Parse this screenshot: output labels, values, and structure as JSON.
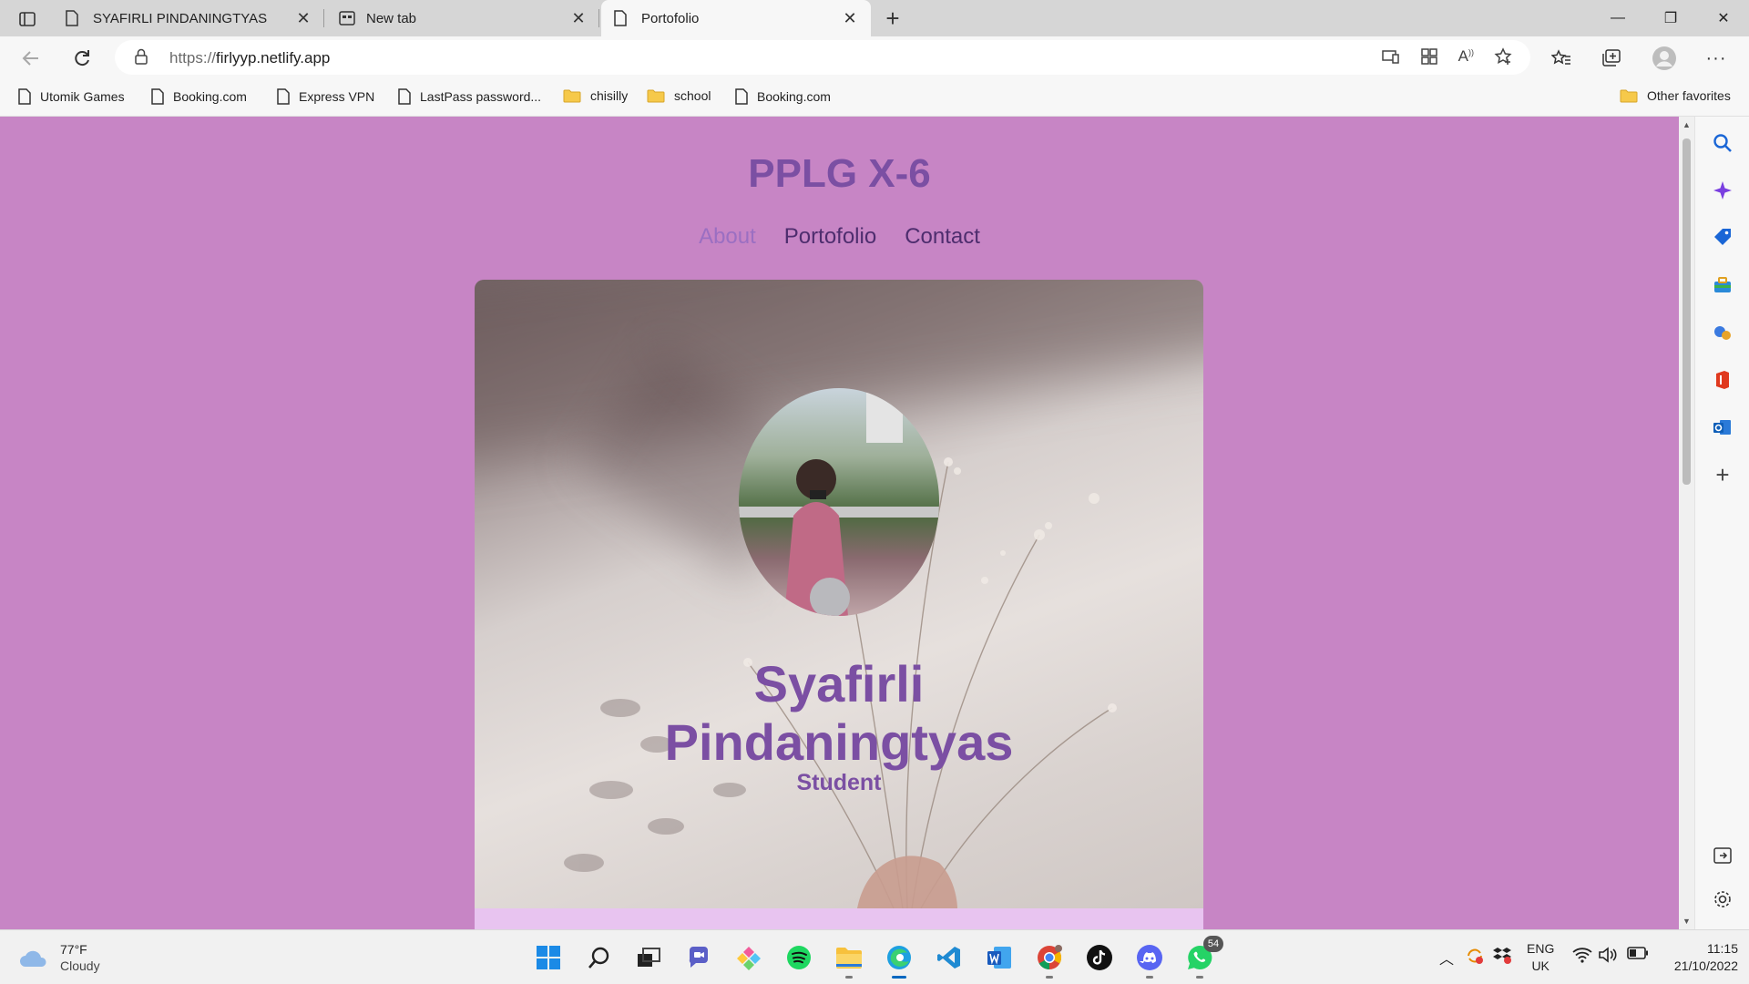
{
  "browser": {
    "tabs": [
      {
        "title": "SYAFIRLI PINDANINGTYAS",
        "icon": "page-icon",
        "active": false
      },
      {
        "title": "New tab",
        "icon": "newtab-icon",
        "active": false
      },
      {
        "title": "Portofolio",
        "icon": "page-icon",
        "active": true
      }
    ],
    "url_protocol": "https://",
    "url_host": "firlyyp.netlify.app",
    "favorites": [
      {
        "label": "Utomik Games",
        "icon": "page-icon"
      },
      {
        "label": "Booking.com",
        "icon": "page-icon"
      },
      {
        "label": "Express VPN",
        "icon": "page-icon"
      },
      {
        "label": "LastPass password...",
        "icon": "page-icon"
      },
      {
        "label": "chisilly",
        "icon": "folder-icon"
      },
      {
        "label": "school",
        "icon": "folder-icon"
      },
      {
        "label": "Booking.com",
        "icon": "page-icon"
      }
    ],
    "other_favorites": "Other favorites"
  },
  "site": {
    "title": "PPLG X-6",
    "nav": [
      {
        "label": "About",
        "active": true
      },
      {
        "label": "Portofolio",
        "active": false
      },
      {
        "label": "Contact",
        "active": false
      }
    ],
    "hero_name_line1": "Syafirli",
    "hero_name_line2": "Pindaningtyas",
    "hero_role": "Student"
  },
  "taskbar": {
    "weather_temp": "77°F",
    "weather_condition": "Cloudy",
    "apps": [
      "windows-start-icon",
      "search-icon",
      "task-view-icon",
      "teams-chat-icon",
      "app-icon",
      "spotify-icon",
      "file-explorer-icon",
      "edge-icon",
      "vscode-icon",
      "word-icon",
      "chrome-icon",
      "tiktok-icon",
      "discord-icon",
      "whatsapp-icon"
    ],
    "whatsapp_badge": "54",
    "lang_line1": "ENG",
    "lang_line2": "UK",
    "time": "11:15",
    "date": "21/10/2022"
  },
  "colors": {
    "page_bg": "#c785c5",
    "title_purple": "#7b4fa3",
    "nav_dark": "#4e2d6e",
    "nav_active": "#9b6fc2",
    "band": "#e8c4f0"
  }
}
